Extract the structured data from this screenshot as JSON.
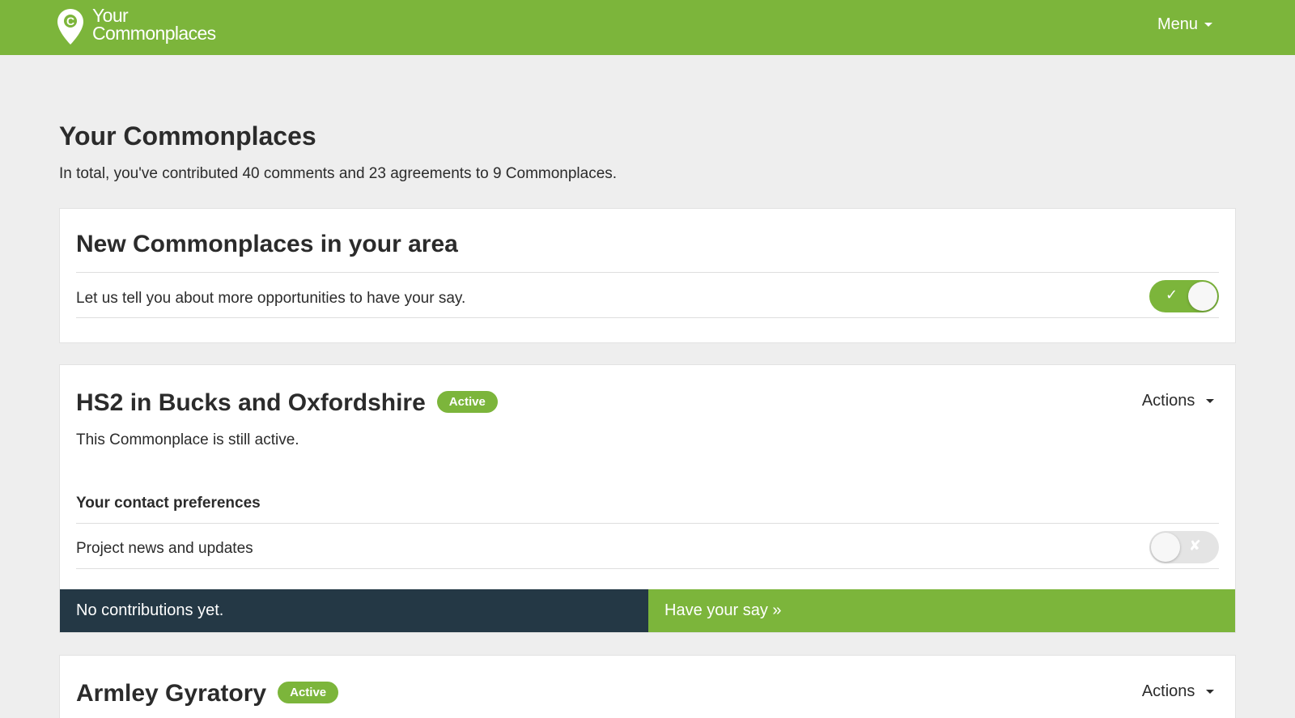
{
  "header": {
    "logo_line1": "Your",
    "logo_line2": "Commonplaces",
    "logo_letter": "C",
    "menu_label": "Menu",
    "brand_color": "#7cb53b"
  },
  "page": {
    "title": "Your Commonplaces",
    "summary": "In total, you've contributed 40 comments and 23 agreements to 9 Commonplaces."
  },
  "area_card": {
    "title": "New Commonplaces in your area",
    "row_text": "Let us tell you about more opportunities to have your say.",
    "toggle_on": true,
    "toggle_glyph": "✓"
  },
  "projects": [
    {
      "title": "HS2 in Bucks and Oxfordshire",
      "badge": "Active",
      "actions_label": "Actions",
      "status_text": "This Commonplace is still active.",
      "prefs_label": "Your contact preferences",
      "pref_row": "Project news and updates",
      "pref_on": false,
      "pref_glyph": "✘",
      "contributions": "No contributions yet.",
      "cta": "Have your say »"
    },
    {
      "title": "Armley Gyratory",
      "badge": "Active",
      "actions_label": "Actions"
    }
  ],
  "colors": {
    "accent": "#7cb53b",
    "dark_bar": "#243845",
    "background": "#eeeeee"
  }
}
